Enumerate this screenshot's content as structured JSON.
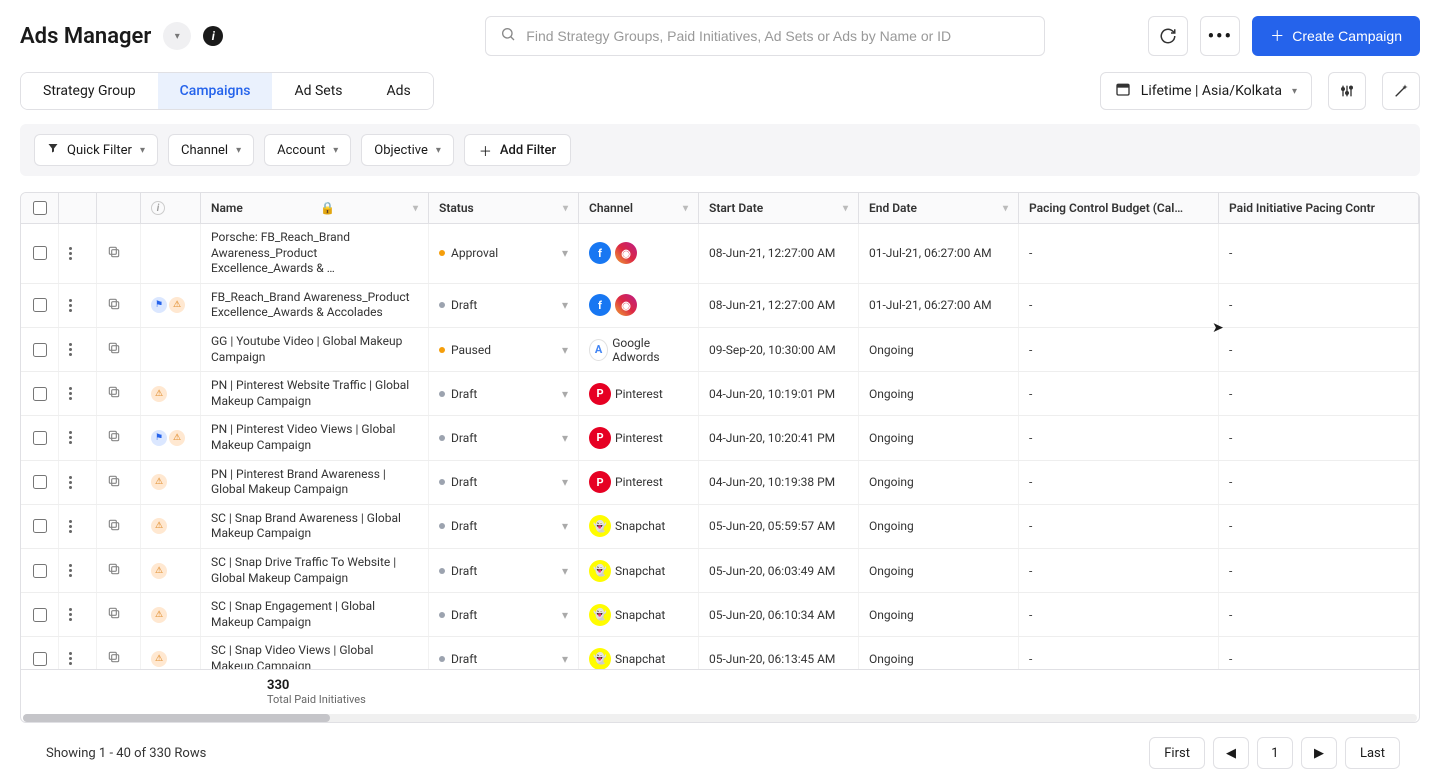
{
  "header": {
    "title": "Ads Manager",
    "search_placeholder": "Find Strategy Groups, Paid Initiatives, Ad Sets or Ads by Name or ID",
    "create_label": "Create Campaign"
  },
  "tabs": {
    "items": [
      {
        "label": "Strategy Group"
      },
      {
        "label": "Campaigns"
      },
      {
        "label": "Ad Sets"
      },
      {
        "label": "Ads"
      }
    ],
    "active_index": 1,
    "timerange_label": "Lifetime | Asia/Kolkata"
  },
  "filters": {
    "quick_filter": "Quick Filter",
    "chips": [
      "Channel",
      "Account",
      "Objective"
    ],
    "add_label": "Add Filter"
  },
  "columns": {
    "name": "Name",
    "status": "Status",
    "channel": "Channel",
    "start": "Start Date",
    "end": "End Date",
    "pacing": "Pacing Control Budget (Cal…",
    "paid": "Paid Initiative Pacing Contr"
  },
  "rows": [
    {
      "name": "Porsche: FB_Reach_Brand Awareness_Product Excellence_Awards & …",
      "status": "Approval",
      "status_kind": "approval",
      "channels": [
        "fb",
        "ig"
      ],
      "channel_label": "",
      "start": "08-Jun-21, 12:27:00 AM",
      "end": "01-Jul-21, 06:27:00 AM",
      "errs": [],
      "pacing": "-",
      "paid": "-"
    },
    {
      "name": "FB_Reach_Brand Awareness_Product Excellence_Awards & Accolades",
      "status": "Draft",
      "status_kind": "draft",
      "channels": [
        "fb",
        "ig"
      ],
      "channel_label": "",
      "start": "08-Jun-21, 12:27:00 AM",
      "end": "01-Jul-21, 06:27:00 AM",
      "errs": [
        "v",
        "w"
      ],
      "pacing": "-",
      "paid": "-"
    },
    {
      "name": "GG | Youtube Video | Global Makeup Campaign",
      "status": "Paused",
      "status_kind": "paused",
      "channels": [
        "gg"
      ],
      "channel_label": "Google Adwords",
      "start": "09-Sep-20, 10:30:00 AM",
      "end": "Ongoing",
      "errs": [],
      "pacing": "-",
      "paid": "-"
    },
    {
      "name": "PN | Pinterest Website Traffic | Global Makeup Campaign",
      "status": "Draft",
      "status_kind": "draft",
      "channels": [
        "pn"
      ],
      "channel_label": "Pinterest",
      "start": "04-Jun-20, 10:19:01 PM",
      "end": "Ongoing",
      "errs": [
        "w"
      ],
      "pacing": "-",
      "paid": "-"
    },
    {
      "name": "PN | Pinterest Video Views | Global Makeup Campaign",
      "status": "Draft",
      "status_kind": "draft",
      "channels": [
        "pn"
      ],
      "channel_label": "Pinterest",
      "start": "04-Jun-20, 10:20:41 PM",
      "end": "Ongoing",
      "errs": [
        "v",
        "w"
      ],
      "pacing": "-",
      "paid": "-"
    },
    {
      "name": "PN | Pinterest Brand Awareness | Global Makeup Campaign",
      "status": "Draft",
      "status_kind": "draft",
      "channels": [
        "pn"
      ],
      "channel_label": "Pinterest",
      "start": "04-Jun-20, 10:19:38 PM",
      "end": "Ongoing",
      "errs": [
        "w"
      ],
      "pacing": "-",
      "paid": "-"
    },
    {
      "name": "SC | Snap Brand Awareness | Global Makeup Campaign",
      "status": "Draft",
      "status_kind": "draft",
      "channels": [
        "sc"
      ],
      "channel_label": "Snapchat",
      "start": "05-Jun-20, 05:59:57 AM",
      "end": "Ongoing",
      "errs": [
        "w"
      ],
      "pacing": "-",
      "paid": "-"
    },
    {
      "name": "SC | Snap Drive Traffic To Website | Global Makeup Campaign",
      "status": "Draft",
      "status_kind": "draft",
      "channels": [
        "sc"
      ],
      "channel_label": "Snapchat",
      "start": "05-Jun-20, 06:03:49 AM",
      "end": "Ongoing",
      "errs": [
        "w"
      ],
      "pacing": "-",
      "paid": "-"
    },
    {
      "name": "SC | Snap Engagement | Global Makeup Campaign",
      "status": "Draft",
      "status_kind": "draft",
      "channels": [
        "sc"
      ],
      "channel_label": "Snapchat",
      "start": "05-Jun-20, 06:10:34 AM",
      "end": "Ongoing",
      "errs": [
        "w"
      ],
      "pacing": "-",
      "paid": "-"
    },
    {
      "name": "SC | Snap Video Views | Global Makeup Campaign",
      "status": "Draft",
      "status_kind": "draft",
      "channels": [
        "sc"
      ],
      "channel_label": "Snapchat",
      "start": "05-Jun-20, 06:13:45 AM",
      "end": "Ongoing",
      "errs": [
        "w"
      ],
      "pacing": "-",
      "paid": "-"
    }
  ],
  "totals": {
    "count": "330",
    "label": "Total Paid Initiatives"
  },
  "pagination": {
    "showing": "Showing 1 - 40 of 330 Rows",
    "first": "First",
    "last": "Last",
    "page": "1"
  }
}
